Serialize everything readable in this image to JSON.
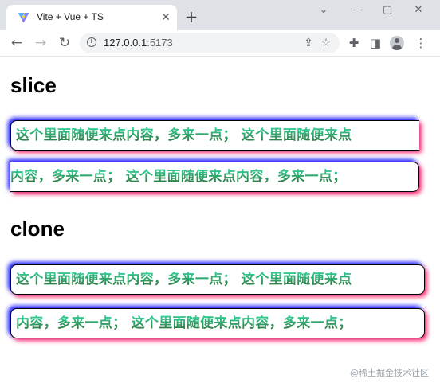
{
  "browser": {
    "tab_title": "Vite + Vue + TS",
    "url_host": "127.0.0.1",
    "url_port": ":5173",
    "icons": {
      "favicon": "vite-logo-icon",
      "tab_close": "close-icon",
      "new_tab": "plus-icon",
      "back": "arrow-left-icon",
      "forward": "arrow-right-icon",
      "reload": "reload-icon",
      "site_info": "info-icon",
      "share": "share-icon",
      "bookmark": "star-icon",
      "extensions": "puzzle-icon",
      "side_panel": "side-panel-icon",
      "profile": "avatar-icon",
      "menu": "kebab-menu-icon"
    }
  },
  "page": {
    "slice_heading": "slice",
    "clone_heading": "clone",
    "slice_line_1": "这个里面随便来点内容，多来一点； 这个里面随便来点",
    "slice_line_2": "内容，多来一点； 这个里面随便来点内容，多来一点；",
    "clone_line_1": "这个里面随便来点内容，多来一点； 这个里面随便来点",
    "clone_line_2": "内容，多来一点； 这个里面随便来点内容，多来一点；",
    "watermark": "@稀土掘金技术社区"
  },
  "colors": {
    "shadow_top_left": "#1a1aff",
    "shadow_bottom_right": "#ff2d6f",
    "text_gradient_top": "#34d399",
    "text_gradient_bottom": "#2f6e37"
  }
}
